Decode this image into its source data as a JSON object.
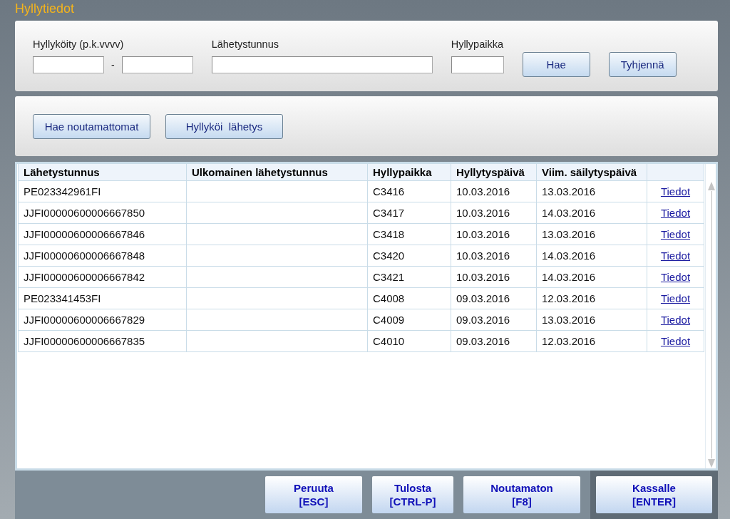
{
  "title": "Hyllytiedot",
  "filters": [
    {
      "kind": "range",
      "label": "Hyllyköity (p.k.vvvv)",
      "separator": "-"
    },
    {
      "kind": "wide",
      "label": "Lähetystunnus"
    },
    {
      "kind": "short",
      "label": "Hyllypaikka"
    }
  ],
  "search_buttons": [
    "Hae",
    "Tyhjennä"
  ],
  "action_buttons": [
    "Hae noutamattomat",
    "Hyllyköi  lähetys"
  ],
  "table": {
    "columns": [
      "Lähetystunnus",
      "Ulkomainen lähetystunnus",
      "Hyllypaikka",
      "Hyllytyspäivä",
      "Viim. säilytyspäivä"
    ],
    "rows": [
      {
        "cells": [
          "PE023342961FI",
          "",
          "C3416",
          "10.03.2016",
          "13.03.2016"
        ],
        "link": "Tiedot"
      },
      {
        "cells": [
          "JJFI00000600006667850",
          "",
          "C3417",
          "10.03.2016",
          "14.03.2016"
        ],
        "link": "Tiedot"
      },
      {
        "cells": [
          "JJFI00000600006667846",
          "",
          "C3418",
          "10.03.2016",
          "13.03.2016"
        ],
        "link": "Tiedot"
      },
      {
        "cells": [
          "JJFI00000600006667848",
          "",
          "C3420",
          "10.03.2016",
          "14.03.2016"
        ],
        "link": "Tiedot"
      },
      {
        "cells": [
          "JJFI00000600006667842",
          "",
          "C3421",
          "10.03.2016",
          "14.03.2016"
        ],
        "link": "Tiedot"
      },
      {
        "cells": [
          "PE023341453FI",
          "",
          "C4008",
          "09.03.2016",
          "12.03.2016"
        ],
        "link": "Tiedot"
      },
      {
        "cells": [
          "JJFI00000600006667829",
          "",
          "C4009",
          "09.03.2016",
          "13.03.2016"
        ],
        "link": "Tiedot"
      },
      {
        "cells": [
          "JJFI00000600006667835",
          "",
          "C4010",
          "09.03.2016",
          "12.03.2016"
        ],
        "link": "Tiedot"
      }
    ]
  },
  "footer_buttons": [
    {
      "label": "Peruuta",
      "key": "[ESC]",
      "default": false
    },
    {
      "label": "Tulosta",
      "key": "[CTRL-P]",
      "default": false
    },
    {
      "label": "Noutamaton",
      "key": "[F8]",
      "default": false
    },
    {
      "label": "Kassalle",
      "key": "[ENTER]",
      "default": true
    }
  ]
}
